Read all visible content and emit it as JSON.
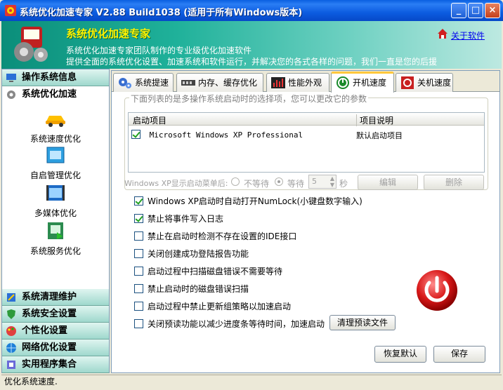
{
  "window": {
    "title": "系统优化加速专家 V2.88 Build1038 (适用于所有Windows版本)",
    "minimize": "_",
    "maximize": "□",
    "close": "×"
  },
  "header": {
    "title": "系统优化加速专家",
    "line1": "系统优化加速专家团队制作的专业级优化加速软件",
    "line2": "提供全面的系统优化设置、加速系统和软件运行，并解决您的各式各样的问题，我们一直是您的后援",
    "about": "关于软件"
  },
  "sidebar": {
    "categories_top": [
      {
        "label": "操作系统信息",
        "icon": "monitor-icon"
      },
      {
        "label": "系统优化加速",
        "icon": "gear-icon"
      }
    ],
    "items": [
      {
        "label": "系统速度优化",
        "icon": "car-icon"
      },
      {
        "label": "自启管理优化",
        "icon": "window-icon"
      },
      {
        "label": "多媒体优化",
        "icon": "film-icon"
      },
      {
        "label": "系统服务优化",
        "icon": "service-icon"
      }
    ],
    "categories_bottom": [
      {
        "label": "系统清理维护",
        "icon": "broom-icon"
      },
      {
        "label": "系统安全设置",
        "icon": "shield-icon"
      },
      {
        "label": "个性化设置",
        "icon": "palette-icon"
      },
      {
        "label": "网络优化设置",
        "icon": "network-icon"
      },
      {
        "label": "实用程序集合",
        "icon": "tools-icon"
      }
    ]
  },
  "tabs": [
    {
      "label": "系统提速",
      "icon": "gears-icon"
    },
    {
      "label": "内存、缓存优化",
      "icon": "memory-icon"
    },
    {
      "label": "性能外观",
      "icon": "chart-icon"
    },
    {
      "label": "开机速度",
      "icon": "power-icon"
    },
    {
      "label": "关机速度",
      "icon": "shutdown-icon"
    }
  ],
  "boot": {
    "caption": "下面列表的是多操作系统启动时的选择项，您可以更改它的参数",
    "col_item": "启动项目",
    "col_desc": "项目说明",
    "row_name": "Microsoft Windows XP Professional",
    "row_desc": "默认启动项目",
    "menu_label": "Windows XP显示启动菜单后:",
    "no_wait": "不等待",
    "wait": "等待",
    "wait_value": "5",
    "seconds": "秒",
    "edit": "编辑",
    "delete": "删除"
  },
  "options": [
    {
      "label": "Windows XP启动时自动打开NumLock(小键盘数字输入)",
      "checked": true
    },
    {
      "label": "禁止将事件写入日志",
      "checked": true
    },
    {
      "label": "禁止在启动时检测不存在设置的IDE接口",
      "checked": false
    },
    {
      "label": "关闭创建成功登陆报告功能",
      "checked": false
    },
    {
      "label": "启动过程中扫描磁盘错误不需要等待",
      "checked": false
    },
    {
      "label": "禁止启动时的磁盘错误扫描",
      "checked": false
    },
    {
      "label": "启动过程中禁止更新组策略以加速启动",
      "checked": false
    },
    {
      "label": "关闭预读功能以减少进度条等待时间，加速启动",
      "checked": false
    }
  ],
  "buttons": {
    "clear_prefetch": "清理预读文件",
    "restore": "恢复默认",
    "save": "保存"
  },
  "statusbar": "优化系统速度."
}
